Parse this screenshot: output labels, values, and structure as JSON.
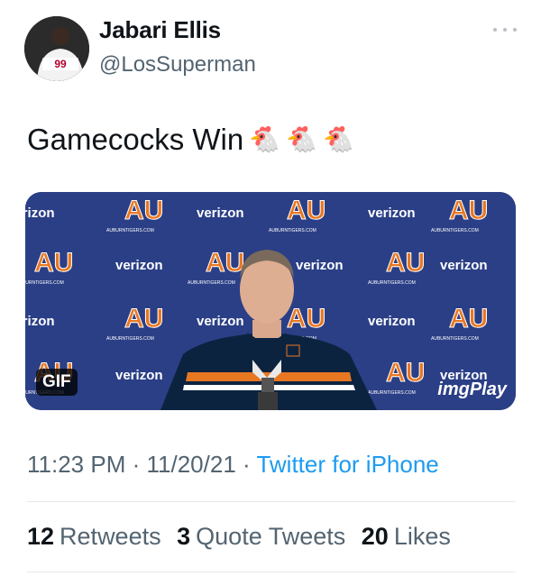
{
  "author": {
    "display_name": "Jabari Ellis",
    "handle": "@LosSuperman",
    "jersey_number": "99"
  },
  "tweet": {
    "text": "Gamecocks Win",
    "emojis": [
      "🐔",
      "🐔",
      "🐔"
    ]
  },
  "media": {
    "badge": "GIF",
    "watermark": "imgPlay",
    "backdrop_sponsor": "verizon",
    "backdrop_logo": "AU",
    "backdrop_url": "AUBURNTIGERS.COM",
    "colors": {
      "navy": "#0c2340",
      "orange": "#e87722",
      "backdrop_blue": "#2b3f86"
    }
  },
  "meta": {
    "time": "11:23 PM",
    "date": "11/20/21",
    "separator": "·",
    "source": "Twitter for iPhone"
  },
  "stats": [
    {
      "count": "12",
      "label": "Retweets"
    },
    {
      "count": "3",
      "label": "Quote Tweets"
    },
    {
      "count": "20",
      "label": "Likes"
    }
  ],
  "colors": {
    "text_primary": "#0f1419",
    "text_secondary": "#536471",
    "link": "#1d9bf0"
  },
  "icons": {
    "more": "more-horizontal-icon"
  }
}
